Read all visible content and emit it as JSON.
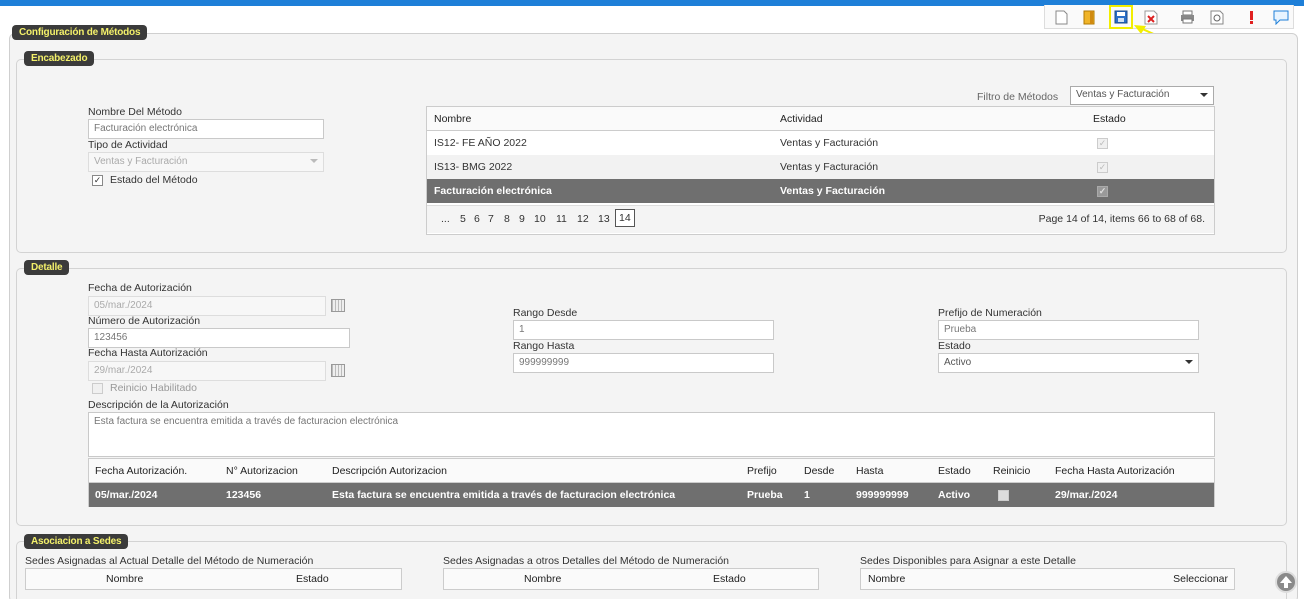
{
  "toolbar": {
    "icons": [
      "new-document-icon",
      "book-icon",
      "save-icon",
      "delete-icon",
      "print-icon",
      "preview-icon",
      "alert-icon",
      "chat-icon"
    ]
  },
  "panel": {
    "title": "Configuración de Métodos"
  },
  "encabezado": {
    "title": "Encabezado",
    "nombre_label": "Nombre Del Método",
    "nombre_value": "Facturación electrónica",
    "tipo_label": "Tipo de Actividad",
    "tipo_value": "Ventas y Facturación",
    "estado_label": "Estado del Método",
    "filtro_label": "Filtro de Métodos",
    "filtro_value": "Ventas y Facturación",
    "table": {
      "headers": [
        "Nombre",
        "Actividad",
        "Estado"
      ],
      "rows": [
        {
          "nombre": "IS12- FE AÑO 2022",
          "actividad": "Ventas y Facturación",
          "estado": "✓"
        },
        {
          "nombre": "IS13- BMG 2022",
          "actividad": "Ventas y Facturación",
          "estado": "✓"
        },
        {
          "nombre": "Facturación electrónica",
          "actividad": "Ventas y Facturación",
          "estado": "✓"
        }
      ],
      "pages": [
        "...",
        "5",
        "6",
        "7",
        "8",
        "9",
        "10",
        "11",
        "12",
        "13",
        "14"
      ],
      "page_info": "Page 14 of 14, items 66 to 68 of 68."
    }
  },
  "detalle": {
    "title": "Detalle",
    "fecha_aut_label": "Fecha de Autorización",
    "fecha_aut_value": "05/mar./2024",
    "num_aut_label": "Número de Autorización",
    "num_aut_value": "123456",
    "fecha_hasta_label": "Fecha Hasta Autorización",
    "fecha_hasta_value": "29/mar./2024",
    "reinicio_label": "Reinicio Habilitado",
    "rango_desde_label": "Rango Desde",
    "rango_desde_value": "1",
    "rango_hasta_label": "Rango Hasta",
    "rango_hasta_value": "999999999",
    "prefijo_label": "Prefijo de Numeración",
    "prefijo_value": "Prueba",
    "estado_label": "Estado",
    "estado_value": "Activo",
    "desc_label": "Descripción de la Autorización",
    "desc_value": "Esta factura se encuentra emitida a través de facturacion electrónica",
    "table": {
      "headers": [
        "Fecha Autorización.",
        "N° Autorizacion",
        "Descripción Autorizacion",
        "Prefijo",
        "Desde",
        "Hasta",
        "Estado",
        "Reinicio",
        "Fecha Hasta Autorización"
      ],
      "row": [
        "05/mar./2024",
        "123456",
        "Esta factura se encuentra emitida a través de facturacion electrónica",
        "Prueba",
        "1",
        "999999999",
        "Activo",
        "",
        "29/mar./2024"
      ]
    }
  },
  "sedes": {
    "title": "Asociacion a Sedes",
    "col1_title": "Sedes Asignadas al Actual Detalle del Método de Numeración",
    "col2_title": "Sedes Asignadas a otros Detalles del Método de Numeración",
    "col3_title": "Sedes Disponibles para Asignar a este Detalle",
    "h_nombre": "Nombre",
    "h_estado": "Estado",
    "h_seleccionar": "Seleccionar"
  }
}
